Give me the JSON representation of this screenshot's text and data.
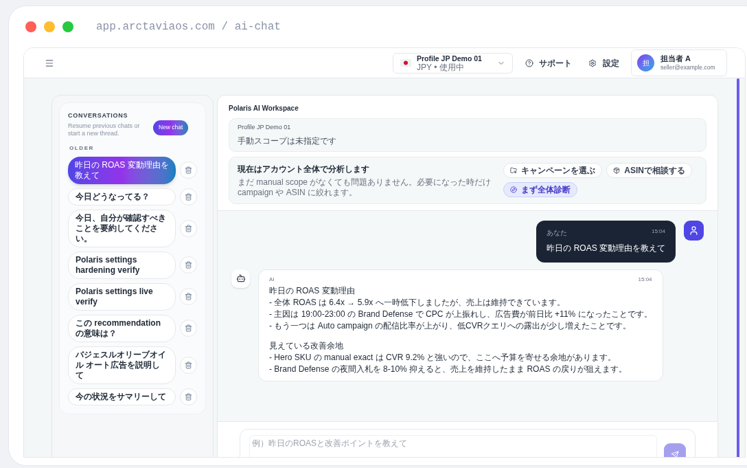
{
  "window": {
    "url": "app.arctaviaos.com / ai-chat"
  },
  "header": {
    "profile": {
      "name": "Profile JP Demo 01",
      "sub": "JPY • 使用中"
    },
    "support": "サポート",
    "settings": "設定",
    "user": {
      "initial": "担",
      "name": "担当者 A",
      "email": "seller@example.com"
    }
  },
  "conversations": {
    "title": "CONVERSATIONS",
    "subtitle": "Resume previous chats or start a new thread.",
    "new_chat": "New chat",
    "group": "OLDER",
    "items": [
      {
        "title": "昨日の ROAS 変動理由を教えて",
        "selected": true
      },
      {
        "title": "今日どうなってる？",
        "selected": false
      },
      {
        "title": "今日、自分が確認すべきことを要約してください。",
        "selected": false
      },
      {
        "title": "Polaris settings hardening verify",
        "selected": false
      },
      {
        "title": "Polaris settings live verify",
        "selected": false
      },
      {
        "title": "この recommendation の意味は？",
        "selected": false
      },
      {
        "title": "バジェスルオリーブオイル オート広告を説明して",
        "selected": false
      },
      {
        "title": "今の状況をサマリーして",
        "selected": false
      }
    ]
  },
  "workspace": {
    "title": "Polaris AI Workspace",
    "profile_card": {
      "name": "Profile JP Demo 01",
      "note": "手動スコープは未指定です"
    },
    "scope": {
      "title": "現在はアカウント全体で分析します",
      "description": "まだ manual scope がなくても問題ありません。必要になった時だけ campaign や ASIN に絞れます。",
      "actions": [
        {
          "label": "キャンペーンを選ぶ",
          "kind": "folder",
          "selected": false
        },
        {
          "label": "ASINで相談する",
          "kind": "box",
          "selected": false
        },
        {
          "label": "まず全体診断",
          "kind": "compass",
          "selected": true
        }
      ]
    }
  },
  "messages": [
    {
      "kind": "user",
      "sender": "あなた",
      "time": "15:04",
      "paragraphs": [
        [
          "昨日の ROAS 変動理由を教えて"
        ]
      ]
    },
    {
      "kind": "assistant",
      "sender": "AI",
      "time": "15:04",
      "paragraphs": [
        [
          "昨日の ROAS 変動理由",
          "- 全体 ROAS は 6.4x → 5.9x へ一時低下しましたが、売上は維持できています。",
          "- 主因は 19:00-23:00 の Brand Defense で CPC が上振れし、広告費が前日比 +11% になったことです。",
          "- もう一つは Auto campaign の配信比率が上がり、低CVRクエリへの露出が少し増えたことです。"
        ],
        [
          "見えている改善余地",
          "- Hero SKU の manual exact は CVR 9.2% と強いので、ここへ予算を寄せる余地があります。",
          "- Brand Defense の夜間入札を 8-10% 抑えると、売上を維持したまま ROAS の戻りが狙えます。"
        ]
      ]
    }
  ],
  "composer": {
    "placeholder": "例）昨日のROASと改善ポイントを教えて"
  }
}
